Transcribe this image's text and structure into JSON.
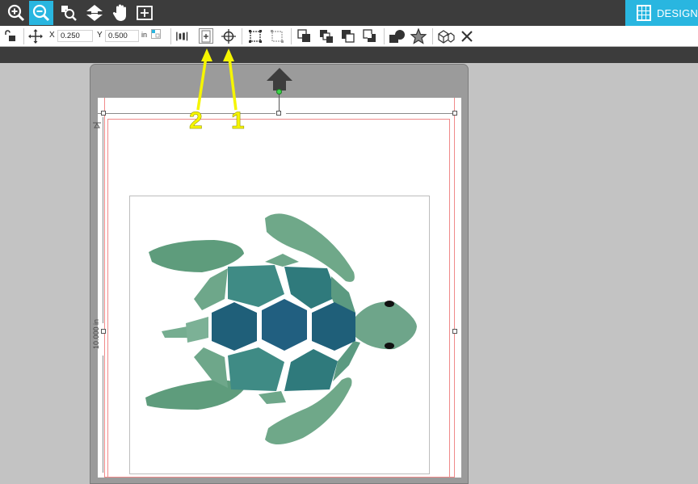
{
  "topbar": {
    "tools": [
      {
        "name": "zoom-in-icon"
      },
      {
        "name": "zoom-out-icon"
      },
      {
        "name": "zoom-selection-icon"
      },
      {
        "name": "fit-to-page-icon"
      },
      {
        "name": "pan-hand-icon"
      },
      {
        "name": "zoom-fit-icon"
      }
    ],
    "design_tab_label": "DESIGN"
  },
  "toolbar": {
    "x_label": "X",
    "x_value": "0.250",
    "y_label": "Y",
    "y_value": "0.500",
    "unit": "in"
  },
  "canvas": {
    "ruler_label": "10.000 in"
  },
  "callouts": {
    "label_1": "1",
    "label_2": "2"
  },
  "colors": {
    "accent": "#29b6e0",
    "topbar": "#3c3c3c",
    "callout": "#f5f500"
  }
}
